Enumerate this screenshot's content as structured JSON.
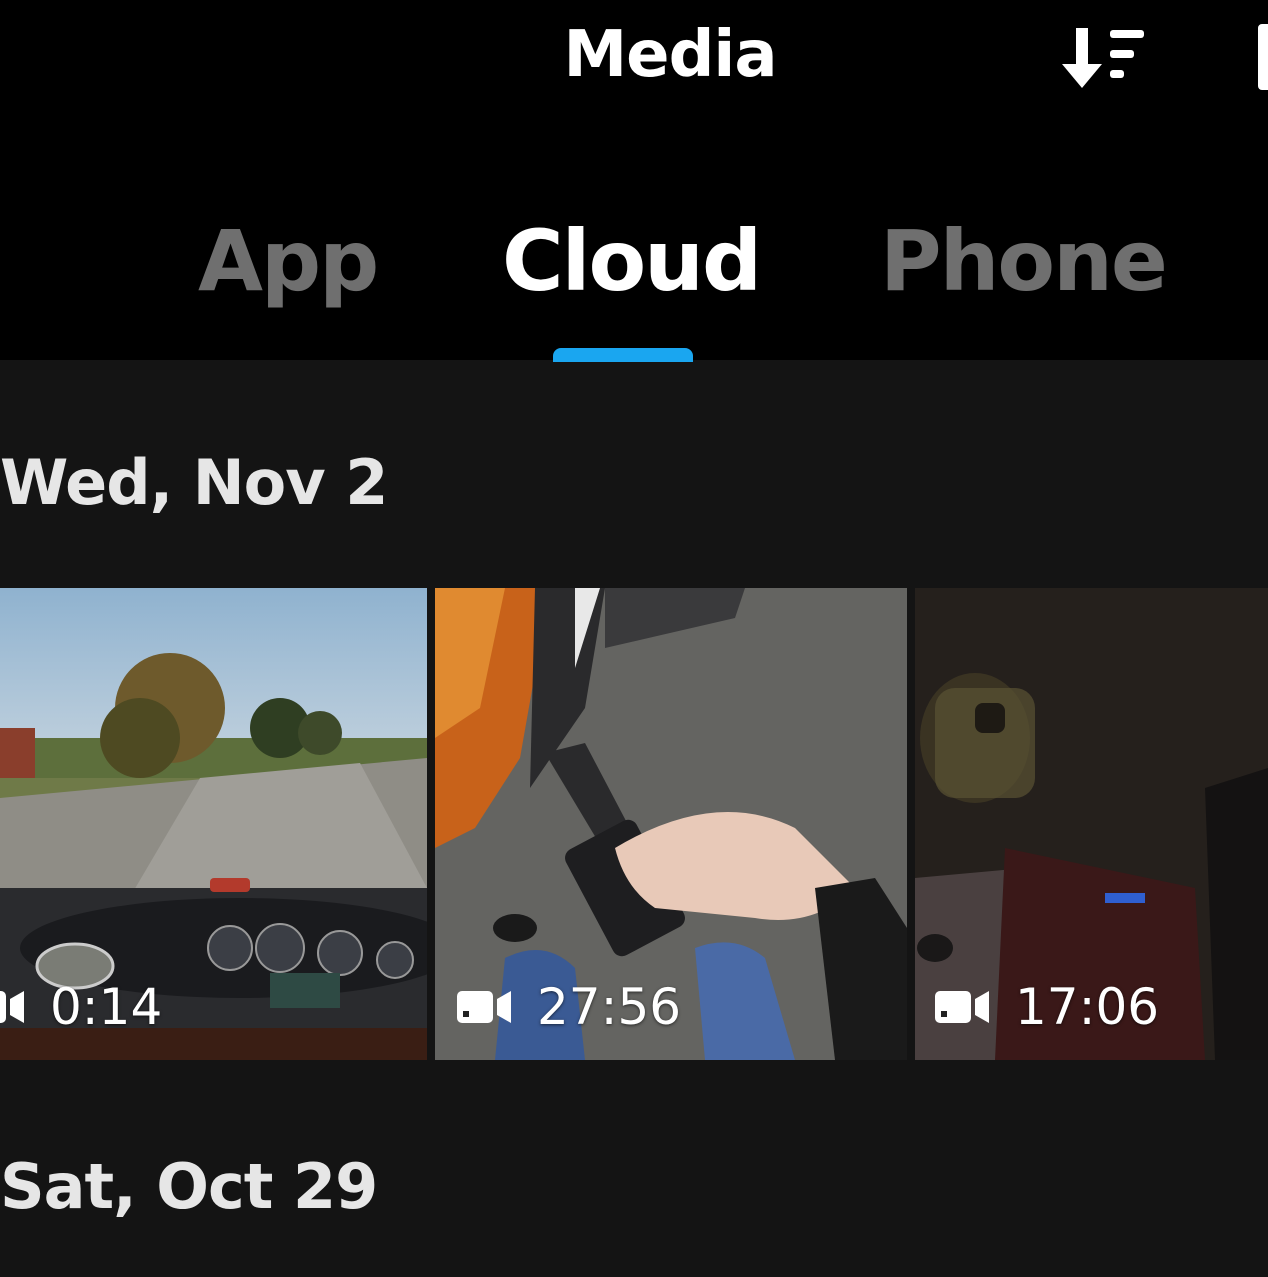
{
  "header": {
    "title": "Media",
    "sort_icon": "sort-descending-icon"
  },
  "tabs": [
    {
      "label": "App",
      "active": false
    },
    {
      "label": "Cloud",
      "active": true
    },
    {
      "label": "Phone",
      "active": false
    }
  ],
  "colors": {
    "accent": "#1aa6f0",
    "background": "#141414",
    "header": "#000000",
    "inactive_tab": "#6f6f6f"
  },
  "sections": [
    {
      "date": "Wed, Nov 2",
      "items": [
        {
          "type": "video",
          "icon": "video-camera-icon",
          "duration": "0:14"
        },
        {
          "type": "video",
          "icon": "video-camera-icon",
          "duration": "27:56"
        },
        {
          "type": "video",
          "icon": "video-camera-icon",
          "duration": "17:06"
        }
      ]
    },
    {
      "date": "Sat, Oct 29",
      "items": []
    }
  ]
}
